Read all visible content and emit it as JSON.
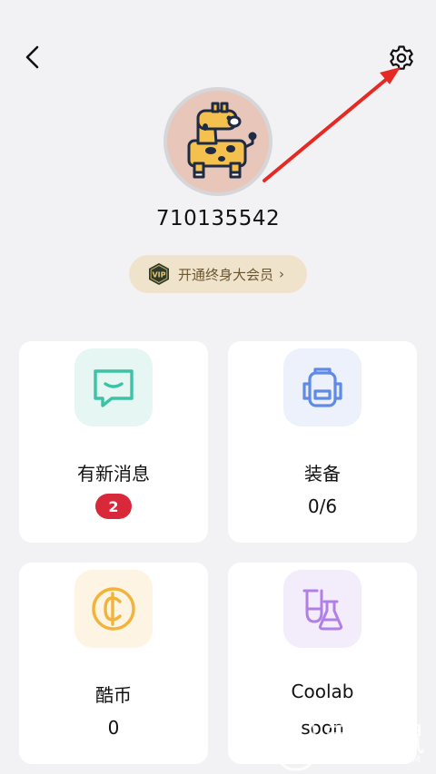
{
  "header": {
    "back_icon": "chevron-left-icon",
    "settings_icon": "gear-icon"
  },
  "profile": {
    "user_id": "710135542",
    "vip_label": "开通终身大会员",
    "vip_badge_text": "VIP"
  },
  "cards": [
    {
      "title": "有新消息",
      "value": "2",
      "icon": "message-icon",
      "icon_bg": "#e6f6f2",
      "icon_color": "#3cc2a5"
    },
    {
      "title": "装备",
      "value": "0/6",
      "icon": "backpack-icon",
      "icon_bg": "#ecf1fb",
      "icon_color": "#5f8ae6"
    },
    {
      "title": "酷币",
      "value": "0",
      "icon": "coin-icon",
      "icon_bg": "#fdf4e3",
      "icon_color": "#f2b33a"
    },
    {
      "title": "Coolab",
      "value": "soon",
      "icon": "flask-icon",
      "icon_bg": "#f2ecfb",
      "icon_color": "#b17fe6"
    }
  ],
  "badge_color": "#d8283a",
  "annotation_color": "#e52a23",
  "watermark": {
    "main": "手机鼠",
    "sub": "SHOUJISHU.COM"
  }
}
